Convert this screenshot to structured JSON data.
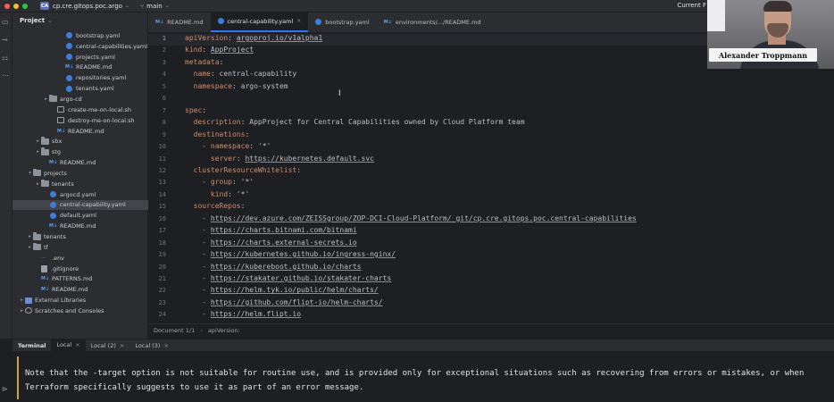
{
  "titlebar": {
    "project_badge": "CA",
    "project_name": "cp.cre.gitops.poc.argo",
    "branch": "main",
    "right_text": "Current F"
  },
  "sidebar": {
    "header": "Project",
    "items": [
      {
        "label": "bootstrap.yaml",
        "type": "yaml",
        "indent": 6,
        "arrow": ""
      },
      {
        "label": "central-capabilities.yaml",
        "type": "yaml",
        "indent": 6,
        "arrow": ""
      },
      {
        "label": "projects.yaml",
        "type": "yaml",
        "indent": 6,
        "arrow": ""
      },
      {
        "label": "README.md",
        "type": "md",
        "indent": 6,
        "arrow": ""
      },
      {
        "label": "repositories.yaml",
        "type": "yaml",
        "indent": 6,
        "arrow": ""
      },
      {
        "label": "tenants.yaml",
        "type": "yaml",
        "indent": 6,
        "arrow": ""
      },
      {
        "label": "argo-cd",
        "type": "folder",
        "indent": 4,
        "arrow": "▸"
      },
      {
        "label": "create-me-on-local.sh",
        "type": "sh",
        "indent": 5,
        "arrow": ""
      },
      {
        "label": "destroy-me-on-local.sh",
        "type": "sh",
        "indent": 5,
        "arrow": ""
      },
      {
        "label": "README.md",
        "type": "md",
        "indent": 5,
        "arrow": ""
      },
      {
        "label": "sbx",
        "type": "folder",
        "indent": 3,
        "arrow": "▸"
      },
      {
        "label": "stg",
        "type": "folder",
        "indent": 3,
        "arrow": "▸"
      },
      {
        "label": "README.md",
        "type": "md",
        "indent": 4,
        "arrow": ""
      },
      {
        "label": "projects",
        "type": "folder",
        "indent": 2,
        "arrow": "▾"
      },
      {
        "label": "tenants",
        "type": "folder",
        "indent": 3,
        "arrow": "▸"
      },
      {
        "label": "argocd.yaml",
        "type": "yaml",
        "indent": 4,
        "arrow": ""
      },
      {
        "label": "central-capability.yaml",
        "type": "yaml",
        "indent": 4,
        "arrow": "",
        "selected": true
      },
      {
        "label": "default.yaml",
        "type": "yaml",
        "indent": 4,
        "arrow": ""
      },
      {
        "label": "README.md",
        "type": "md",
        "indent": 4,
        "arrow": ""
      },
      {
        "label": "tenants",
        "type": "folder",
        "indent": 2,
        "arrow": "▸"
      },
      {
        "label": "tf",
        "type": "folder",
        "indent": 2,
        "arrow": "▸"
      },
      {
        "label": ".env",
        "type": "env",
        "indent": 3,
        "arrow": ""
      },
      {
        "label": ".gitignore",
        "type": "txt",
        "indent": 3,
        "arrow": ""
      },
      {
        "label": "PATTERNS.md",
        "type": "md",
        "indent": 3,
        "arrow": ""
      },
      {
        "label": "README.md",
        "type": "md",
        "indent": 3,
        "arrow": ""
      },
      {
        "label": "External Libraries",
        "type": "lib",
        "indent": 1,
        "arrow": "▸"
      },
      {
        "label": "Scratches and Consoles",
        "type": "scratch",
        "indent": 1,
        "arrow": "▸"
      }
    ]
  },
  "editor": {
    "tabs": [
      {
        "label": "README.md",
        "icon": "md",
        "active": false,
        "close": ""
      },
      {
        "label": "central-capability.yaml",
        "icon": "yaml",
        "active": true,
        "close": "×"
      },
      {
        "label": "bootstrap.yaml",
        "icon": "yaml",
        "active": false,
        "close": ""
      },
      {
        "label": "environments/.../README.md",
        "icon": "md",
        "active": false,
        "close": ""
      }
    ],
    "line_numbers": [
      "1",
      "2",
      "3",
      "4",
      "5",
      "6",
      "7",
      "8",
      "9",
      "10",
      "11",
      "12",
      "13",
      "14",
      "15",
      "16",
      "17",
      "18",
      "19",
      "20",
      "21",
      "22",
      "23",
      "24"
    ],
    "lines": [
      [
        [
          "k",
          "apiVersion"
        ],
        [
          "v",
          ": "
        ],
        [
          "u",
          "argoproj.io/v1alpha1"
        ]
      ],
      [
        [
          "k",
          "kind"
        ],
        [
          "v",
          ": "
        ],
        [
          "u",
          "AppProject"
        ]
      ],
      [
        [
          "k",
          "metadata"
        ],
        [
          "v",
          ":"
        ]
      ],
      [
        [
          "v",
          "  "
        ],
        [
          "k",
          "name"
        ],
        [
          "v",
          ": central-capability"
        ]
      ],
      [
        [
          "v",
          "  "
        ],
        [
          "k",
          "namespace"
        ],
        [
          "v",
          ": argo-system"
        ]
      ],
      [],
      [
        [
          "k",
          "spec"
        ],
        [
          "v",
          ":"
        ]
      ],
      [
        [
          "v",
          "  "
        ],
        [
          "k",
          "description"
        ],
        [
          "v",
          ": AppProject for Central Capabilities owned by Cloud Platform team"
        ]
      ],
      [
        [
          "v",
          "  "
        ],
        [
          "k",
          "destinations"
        ],
        [
          "v",
          ":"
        ]
      ],
      [
        [
          "v",
          "    "
        ],
        [
          "dash",
          "- "
        ],
        [
          "k",
          "namespace"
        ],
        [
          "v",
          ": '*'"
        ]
      ],
      [
        [
          "v",
          "      "
        ],
        [
          "k",
          "server"
        ],
        [
          "v",
          ": "
        ],
        [
          "u",
          "https://kubernetes.default.svc"
        ]
      ],
      [
        [
          "v",
          "  "
        ],
        [
          "k",
          "clusterResourceWhitelist"
        ],
        [
          "v",
          ":"
        ]
      ],
      [
        [
          "v",
          "    "
        ],
        [
          "dash",
          "- "
        ],
        [
          "k",
          "group"
        ],
        [
          "v",
          ": '*'"
        ]
      ],
      [
        [
          "v",
          "      "
        ],
        [
          "k",
          "kind"
        ],
        [
          "v",
          ": '*'"
        ]
      ],
      [
        [
          "v",
          "  "
        ],
        [
          "k",
          "sourceRepos"
        ],
        [
          "v",
          ":"
        ]
      ],
      [
        [
          "v",
          "    "
        ],
        [
          "dash",
          "- "
        ],
        [
          "u",
          "https://dev.azure.com/ZEISSgroup/ZOP-DCI-Cloud-Platform/_git/cp.cre.gitops.poc.central-capabilities"
        ]
      ],
      [
        [
          "v",
          "    "
        ],
        [
          "dash",
          "- "
        ],
        [
          "u",
          "https://charts.bitnami.com/bitnami"
        ]
      ],
      [
        [
          "v",
          "    "
        ],
        [
          "dash",
          "- "
        ],
        [
          "u",
          "https://charts.external-secrets.io"
        ]
      ],
      [
        [
          "v",
          "    "
        ],
        [
          "dash",
          "- "
        ],
        [
          "u",
          "https://kubernetes.github.io/ingress-nginx/"
        ]
      ],
      [
        [
          "v",
          "    "
        ],
        [
          "dash",
          "- "
        ],
        [
          "u",
          "https://kubereboot.github.io/charts"
        ]
      ],
      [
        [
          "v",
          "    "
        ],
        [
          "dash",
          "- "
        ],
        [
          "u",
          "https://stakater.github.io/stakater-charts"
        ]
      ],
      [
        [
          "v",
          "    "
        ],
        [
          "dash",
          "- "
        ],
        [
          "u",
          "https://helm.tyk.io/public/helm/charts/"
        ]
      ],
      [
        [
          "v",
          "    "
        ],
        [
          "dash",
          "- "
        ],
        [
          "u",
          "https://github.com/flipt-io/helm-charts/"
        ]
      ],
      [
        [
          "v",
          "    "
        ],
        [
          "dash",
          "- "
        ],
        [
          "u",
          "https://helm.flipt.io"
        ]
      ]
    ],
    "breadcrumb": [
      "Document 1/1",
      "apiVersion:"
    ]
  },
  "terminal": {
    "tabs": [
      {
        "label": "Terminal",
        "kind": "label",
        "close": ""
      },
      {
        "label": "Local",
        "kind": "active",
        "close": "×"
      },
      {
        "label": "Local (2)",
        "kind": "normal",
        "close": "×"
      },
      {
        "label": "Local (3)",
        "kind": "normal",
        "close": "×"
      }
    ],
    "lines": [
      "Note that the -target option is not suitable for routine use, and is provided only for exceptional situations such as recovering from errors or mistakes, or when",
      "Terraform specifically suggests to use it as part of an error message."
    ]
  },
  "webcam": {
    "name": "Alexander Troppmann"
  },
  "colors": {
    "accent": "#3574f0",
    "yaml_key": "#cf8e6d",
    "panel_bg": "#2b2d30",
    "editor_bg": "#1e1f22"
  }
}
